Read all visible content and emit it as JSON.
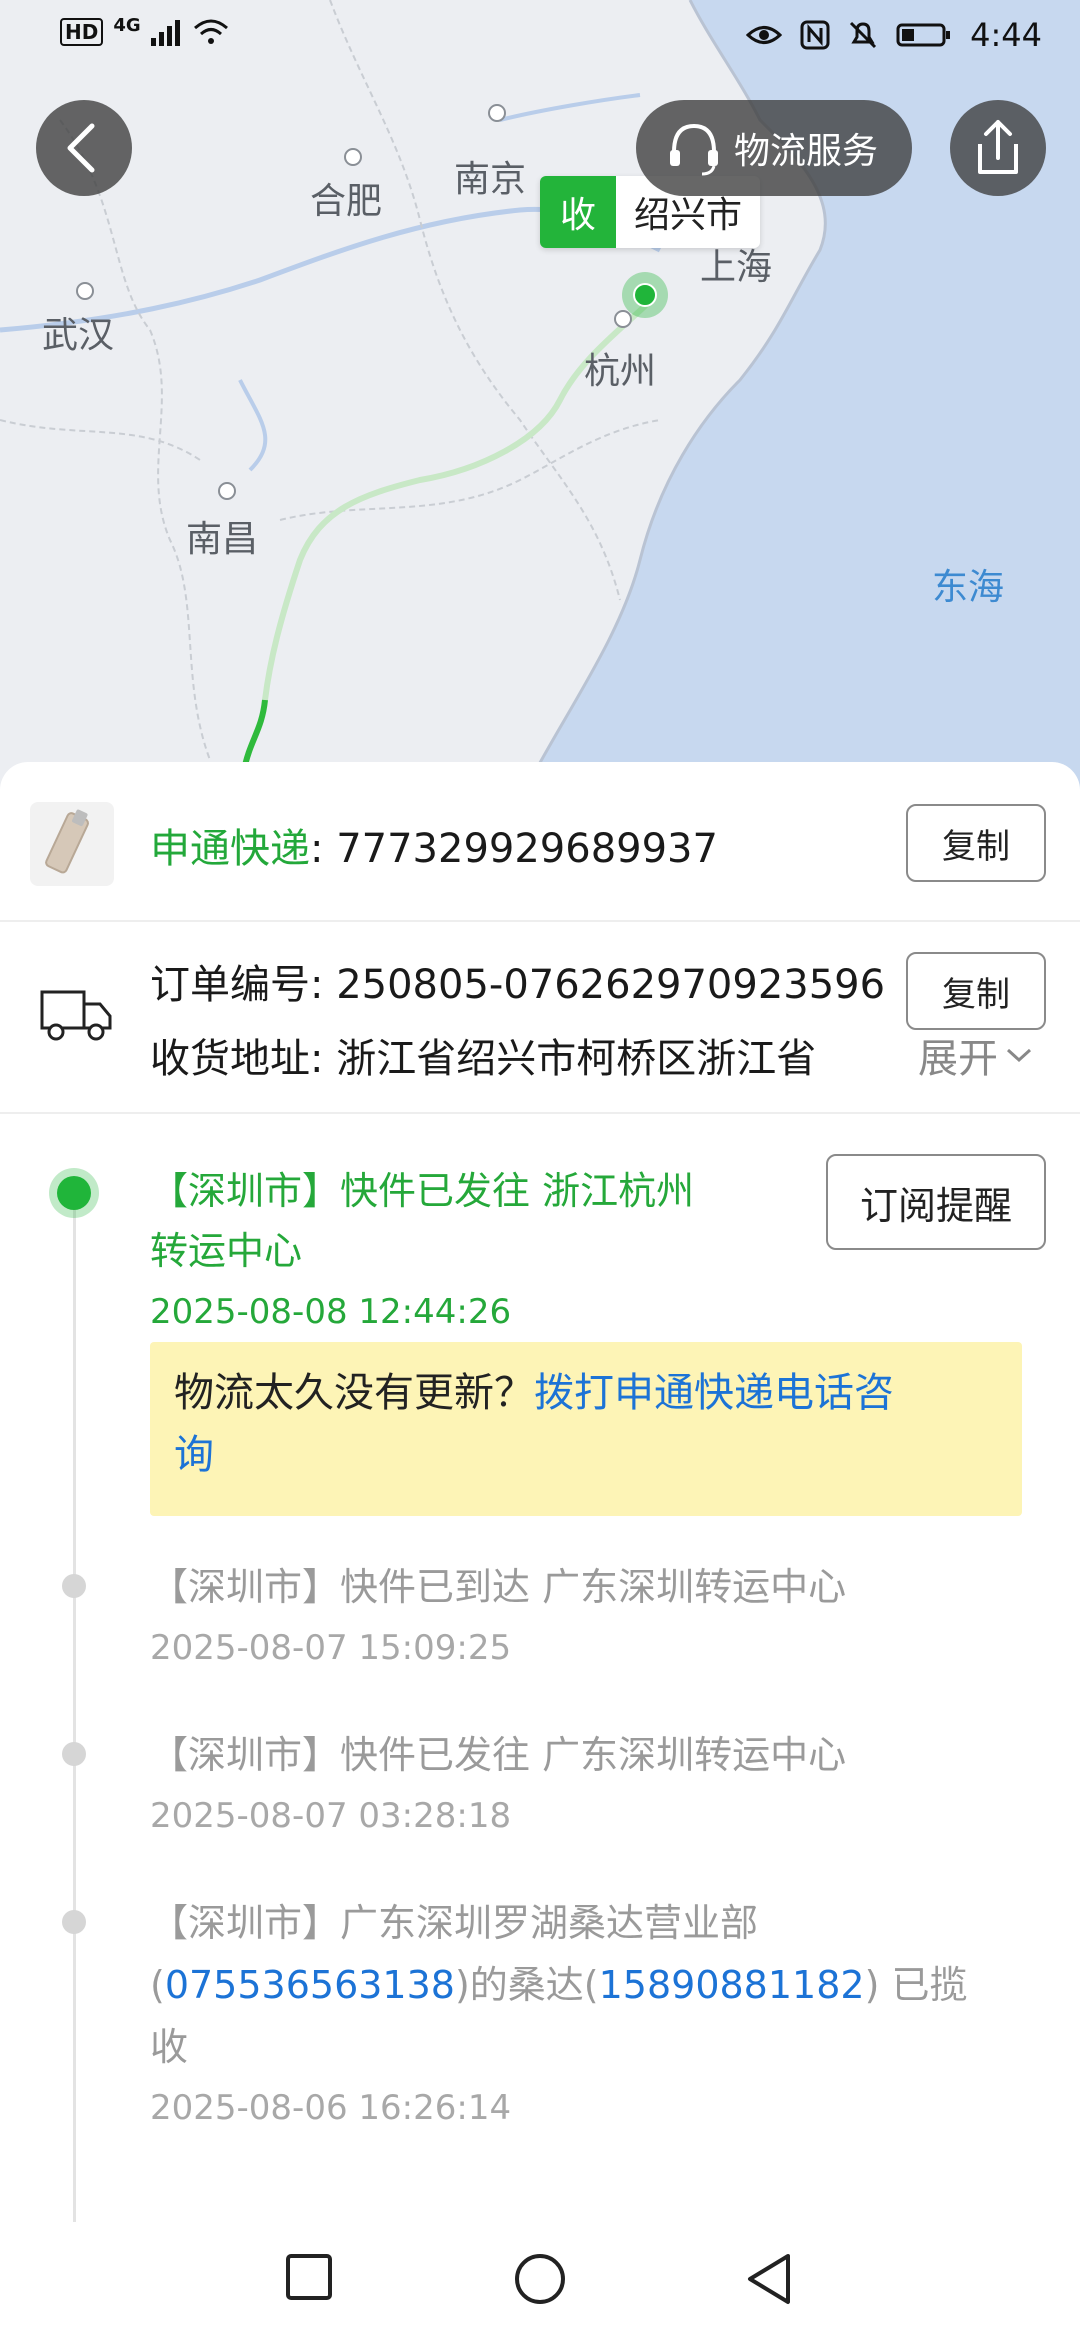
{
  "status_bar": {
    "hd_badge": "HD",
    "network": "4G",
    "time": "4:44"
  },
  "map": {
    "cities": [
      "合肥",
      "南京",
      "上海",
      "武汉",
      "杭州",
      "南昌"
    ],
    "sea_label": "东海",
    "destination": {
      "badge": "收",
      "name": "绍兴市"
    },
    "service_label": "物流服务"
  },
  "express": {
    "carrier": "申通快递",
    "separator": ": ",
    "tracking_number": "777329929689937",
    "copy_label": "复制"
  },
  "order": {
    "order_label": "订单编号",
    "order_number": "250805-076262970923596",
    "copy_label": "复制",
    "address_label": "收货地址",
    "address_value": "浙江省绍兴市柯桥区浙江省",
    "expand_label": "展开"
  },
  "timeline": {
    "subscribe_label": "订阅提醒",
    "events": [
      {
        "line1": "【深圳市】快件已发往 浙江杭州",
        "line2": "转运中心",
        "time": "2025-08-08 12:44:26"
      },
      {
        "line1": "【深圳市】快件已到达 广东深圳转运中心",
        "time": "2025-08-07 15:09:25"
      },
      {
        "line1": "【深圳市】快件已发往 广东深圳转运中心",
        "time": "2025-08-07 03:28:18"
      },
      {
        "line1": "【深圳市】广东深圳罗湖桑达营业部",
        "l2a": "(",
        "phone1": "075536563138",
        "l2b": ")的桑达(",
        "phone2": "15890881182",
        "l2c": ") 已揽",
        "line3": "收",
        "time": "2025-08-06 16:26:14"
      }
    ],
    "notice": {
      "text": "物流太久没有更新？",
      "link_part1": "拨打申通快递电话咨",
      "link_part2": "询"
    }
  },
  "colors": {
    "accent_green": "#20b53a",
    "link_blue": "#1c73d6",
    "notice_bg": "#fdf4b6"
  }
}
